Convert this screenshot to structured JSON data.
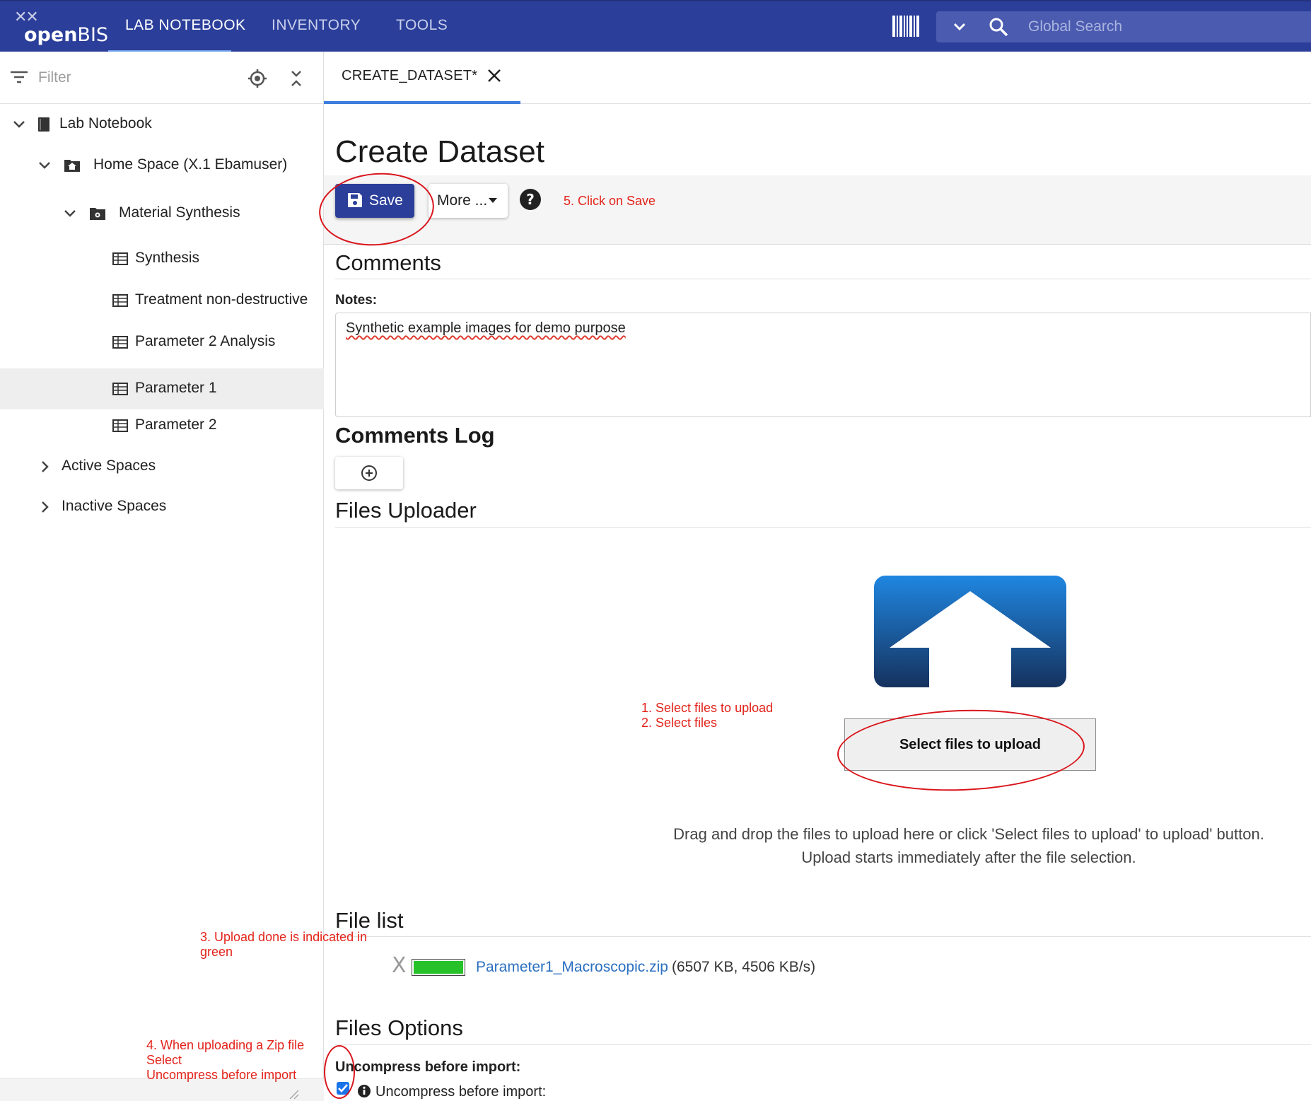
{
  "app": {
    "logo": "openBIS",
    "nav_tabs": [
      {
        "label": "LAB NOTEBOOK",
        "active": true
      },
      {
        "label": "INVENTORY",
        "active": false
      },
      {
        "label": "TOOLS",
        "active": false
      }
    ],
    "search": {
      "placeholder": "Global Search"
    },
    "icons": [
      "barcode-icon",
      "chevron-down-icon",
      "search-icon"
    ],
    "colors": {
      "header": "#2b3f9a",
      "accent": "#3b7ddd",
      "annotation": "#e2231a",
      "upload_done": "#27c22a"
    }
  },
  "sidebar": {
    "filter_placeholder": "Filter",
    "tree": [
      {
        "label": "Lab Notebook",
        "icon": "notebook-icon",
        "expanded": true
      },
      {
        "label": "Home Space (X.1 Ebamuser)",
        "icon": "home-folder-icon",
        "expanded": true
      },
      {
        "label": "Material Synthesis",
        "icon": "project-folder-icon",
        "expanded": true
      },
      {
        "label": "Synthesis",
        "icon": "table-icon"
      },
      {
        "label": "Treatment non-destructive",
        "icon": "table-icon"
      },
      {
        "label": "Parameter 2 Analysis",
        "icon": "table-icon"
      },
      {
        "label": "Parameter 1",
        "icon": "table-icon",
        "selected": true
      },
      {
        "label": "Parameter 2",
        "icon": "table-icon"
      },
      {
        "label": "Active Spaces",
        "icon": "chevron-right-icon"
      },
      {
        "label": "Inactive Spaces",
        "icon": "chevron-right-icon"
      }
    ]
  },
  "tabs": [
    {
      "label": "CREATE_DATASET*",
      "active": true
    }
  ],
  "form": {
    "title": "Create Dataset",
    "toolbar": {
      "save_label": "Save",
      "more_label": "More ..."
    },
    "comments_title": "Comments",
    "notes_label": "Notes:",
    "notes_value": "Synthetic example images for demo purpose",
    "comments_log_title": "Comments Log",
    "files_uploader_title": "Files Uploader",
    "select_files_label": "Select files to upload",
    "drop_hint_1": "Drag and drop the files to upload here or click 'Select files to upload' to upload' button.",
    "drop_hint_2": "Upload starts immediately after the file selection.",
    "file_list_title": "File list",
    "files": [
      {
        "remove_label": "X",
        "progress": 1.0,
        "name": "Parameter1_Macroscopic.zip",
        "meta": "(6507 KB, 4506 KB/s)"
      }
    ],
    "files_options_title": "Files Options",
    "uncompress_label": "Uncompress before import:",
    "uncompress_checkbox_label": "Uncompress before import:",
    "uncompress_checked": true
  },
  "annotations": {
    "step5": "5. Click on Save",
    "step1": "1. Select files to upload",
    "step2": "2. Select files",
    "step3_line1": "3. Upload done is indicated in",
    "step3_line2": "green",
    "step4_line1": "4. When uploading a Zip file",
    "step4_line2": "Select",
    "step4_line3": "Uncompress before import"
  }
}
